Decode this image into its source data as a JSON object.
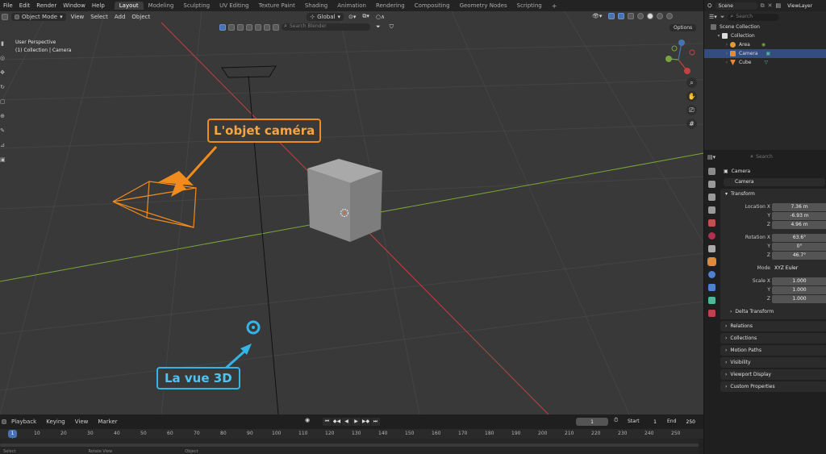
{
  "top_menu": [
    "File",
    "Edit",
    "Render",
    "Window",
    "Help"
  ],
  "workspace_tabs": [
    "Layout",
    "Modeling",
    "Sculpting",
    "UV Editing",
    "Texture Paint",
    "Shading",
    "Animation",
    "Rendering",
    "Compositing",
    "Geometry Nodes",
    "Scripting"
  ],
  "active_workspace": "Layout",
  "viewport": {
    "mode": "Object Mode",
    "menus": [
      "View",
      "Select",
      "Add",
      "Object"
    ],
    "orientation": "Global",
    "search_placeholder": "Search Blender",
    "options_label": "Options",
    "perspective_label": "User Perspective",
    "collection_label": "(1) Collection | Camera",
    "callout_camera": "L'objet caméra",
    "callout_3d": "La vue 3D",
    "colors": {
      "background": "#393939",
      "x_axis": "#c4413f",
      "y_axis": "#7aa53a",
      "camera": "#f08c1e",
      "callout_blue": "#35b4e8"
    }
  },
  "timeline": {
    "menus": [
      "Playback",
      "Keying",
      "View",
      "Marker"
    ],
    "current_frame": "1",
    "start_label": "Start",
    "start_value": "1",
    "end_label": "End",
    "end_value": "250",
    "ruler": [
      "1",
      "10",
      "20",
      "30",
      "40",
      "50",
      "60",
      "70",
      "80",
      "90",
      "100",
      "110",
      "120",
      "130",
      "140",
      "150",
      "160",
      "170",
      "180",
      "190",
      "200",
      "210",
      "220",
      "230",
      "240",
      "250"
    ]
  },
  "status_bar": [
    "Select",
    "Rotate View",
    "Object"
  ],
  "outliner": {
    "scene": "Scene",
    "view_layer": "ViewLayer",
    "search_placeholder": "Search",
    "items": [
      {
        "label": "Scene Collection",
        "icon": "scene-collection-icon"
      },
      {
        "label": "Collection",
        "icon": "collection-icon"
      },
      {
        "label": "Area",
        "icon": "light-icon"
      },
      {
        "label": "Camera",
        "icon": "camera-icon",
        "selected": true
      },
      {
        "label": "Cube",
        "icon": "mesh-icon"
      }
    ]
  },
  "properties": {
    "search_placeholder": "Search",
    "object_name": "Camera",
    "object_field": "Camera",
    "transform_label": "Transform",
    "location": {
      "label": "Location X",
      "x": "7.36 m",
      "y": "-6.93 m",
      "z": "4.96 m"
    },
    "rotation": {
      "label": "Rotation X",
      "x": "63.6°",
      "y": "0°",
      "z": "46.7°"
    },
    "mode_label": "Mode",
    "mode_value": "XYZ Euler",
    "scale": {
      "label": "Scale X",
      "x": "1.000",
      "y": "1.000",
      "z": "1.000"
    },
    "y_label": "Y",
    "z_label": "Z",
    "delta_transform": "Delta Transform",
    "panels": [
      "Relations",
      "Collections",
      "Motion Paths",
      "Visibility",
      "Viewport Display",
      "Custom Properties"
    ]
  }
}
